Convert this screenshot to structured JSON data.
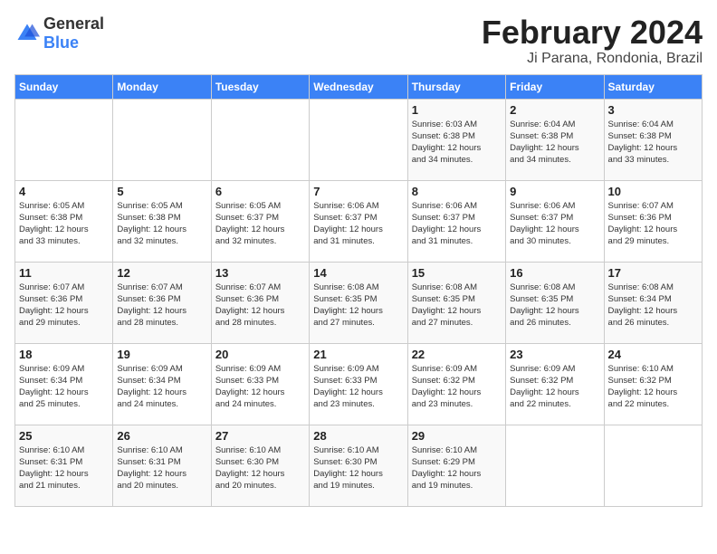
{
  "logo": {
    "general": "General",
    "blue": "Blue"
  },
  "header": {
    "month": "February 2024",
    "location": "Ji Parana, Rondonia, Brazil"
  },
  "days_of_week": [
    "Sunday",
    "Monday",
    "Tuesday",
    "Wednesday",
    "Thursday",
    "Friday",
    "Saturday"
  ],
  "weeks": [
    [
      {
        "day": "",
        "info": ""
      },
      {
        "day": "",
        "info": ""
      },
      {
        "day": "",
        "info": ""
      },
      {
        "day": "",
        "info": ""
      },
      {
        "day": "1",
        "info": "Sunrise: 6:03 AM\nSunset: 6:38 PM\nDaylight: 12 hours\nand 34 minutes."
      },
      {
        "day": "2",
        "info": "Sunrise: 6:04 AM\nSunset: 6:38 PM\nDaylight: 12 hours\nand 34 minutes."
      },
      {
        "day": "3",
        "info": "Sunrise: 6:04 AM\nSunset: 6:38 PM\nDaylight: 12 hours\nand 33 minutes."
      }
    ],
    [
      {
        "day": "4",
        "info": "Sunrise: 6:05 AM\nSunset: 6:38 PM\nDaylight: 12 hours\nand 33 minutes."
      },
      {
        "day": "5",
        "info": "Sunrise: 6:05 AM\nSunset: 6:38 PM\nDaylight: 12 hours\nand 32 minutes."
      },
      {
        "day": "6",
        "info": "Sunrise: 6:05 AM\nSunset: 6:37 PM\nDaylight: 12 hours\nand 32 minutes."
      },
      {
        "day": "7",
        "info": "Sunrise: 6:06 AM\nSunset: 6:37 PM\nDaylight: 12 hours\nand 31 minutes."
      },
      {
        "day": "8",
        "info": "Sunrise: 6:06 AM\nSunset: 6:37 PM\nDaylight: 12 hours\nand 31 minutes."
      },
      {
        "day": "9",
        "info": "Sunrise: 6:06 AM\nSunset: 6:37 PM\nDaylight: 12 hours\nand 30 minutes."
      },
      {
        "day": "10",
        "info": "Sunrise: 6:07 AM\nSunset: 6:36 PM\nDaylight: 12 hours\nand 29 minutes."
      }
    ],
    [
      {
        "day": "11",
        "info": "Sunrise: 6:07 AM\nSunset: 6:36 PM\nDaylight: 12 hours\nand 29 minutes."
      },
      {
        "day": "12",
        "info": "Sunrise: 6:07 AM\nSunset: 6:36 PM\nDaylight: 12 hours\nand 28 minutes."
      },
      {
        "day": "13",
        "info": "Sunrise: 6:07 AM\nSunset: 6:36 PM\nDaylight: 12 hours\nand 28 minutes."
      },
      {
        "day": "14",
        "info": "Sunrise: 6:08 AM\nSunset: 6:35 PM\nDaylight: 12 hours\nand 27 minutes."
      },
      {
        "day": "15",
        "info": "Sunrise: 6:08 AM\nSunset: 6:35 PM\nDaylight: 12 hours\nand 27 minutes."
      },
      {
        "day": "16",
        "info": "Sunrise: 6:08 AM\nSunset: 6:35 PM\nDaylight: 12 hours\nand 26 minutes."
      },
      {
        "day": "17",
        "info": "Sunrise: 6:08 AM\nSunset: 6:34 PM\nDaylight: 12 hours\nand 26 minutes."
      }
    ],
    [
      {
        "day": "18",
        "info": "Sunrise: 6:09 AM\nSunset: 6:34 PM\nDaylight: 12 hours\nand 25 minutes."
      },
      {
        "day": "19",
        "info": "Sunrise: 6:09 AM\nSunset: 6:34 PM\nDaylight: 12 hours\nand 24 minutes."
      },
      {
        "day": "20",
        "info": "Sunrise: 6:09 AM\nSunset: 6:33 PM\nDaylight: 12 hours\nand 24 minutes."
      },
      {
        "day": "21",
        "info": "Sunrise: 6:09 AM\nSunset: 6:33 PM\nDaylight: 12 hours\nand 23 minutes."
      },
      {
        "day": "22",
        "info": "Sunrise: 6:09 AM\nSunset: 6:32 PM\nDaylight: 12 hours\nand 23 minutes."
      },
      {
        "day": "23",
        "info": "Sunrise: 6:09 AM\nSunset: 6:32 PM\nDaylight: 12 hours\nand 22 minutes."
      },
      {
        "day": "24",
        "info": "Sunrise: 6:10 AM\nSunset: 6:32 PM\nDaylight: 12 hours\nand 22 minutes."
      }
    ],
    [
      {
        "day": "25",
        "info": "Sunrise: 6:10 AM\nSunset: 6:31 PM\nDaylight: 12 hours\nand 21 minutes."
      },
      {
        "day": "26",
        "info": "Sunrise: 6:10 AM\nSunset: 6:31 PM\nDaylight: 12 hours\nand 20 minutes."
      },
      {
        "day": "27",
        "info": "Sunrise: 6:10 AM\nSunset: 6:30 PM\nDaylight: 12 hours\nand 20 minutes."
      },
      {
        "day": "28",
        "info": "Sunrise: 6:10 AM\nSunset: 6:30 PM\nDaylight: 12 hours\nand 19 minutes."
      },
      {
        "day": "29",
        "info": "Sunrise: 6:10 AM\nSunset: 6:29 PM\nDaylight: 12 hours\nand 19 minutes."
      },
      {
        "day": "",
        "info": ""
      },
      {
        "day": "",
        "info": ""
      }
    ]
  ]
}
